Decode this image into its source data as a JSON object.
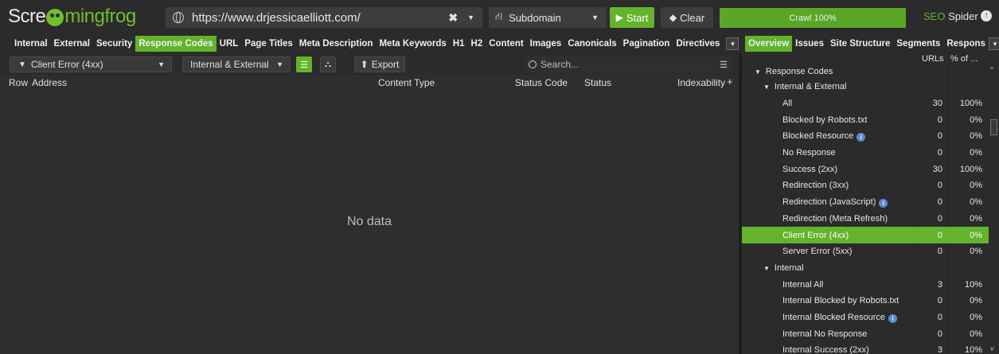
{
  "app": {
    "logo_text_a": "Scre",
    "logo_text_b": "mingfrog",
    "url": "https://www.drjessicaelliott.com/",
    "mode": "Subdomain",
    "start_label": "Start",
    "clear_label": "Clear",
    "crawl_status": "Crawl 100%",
    "product_seo": "SEO",
    "product_spider": "Spider"
  },
  "tabs": [
    "Internal",
    "External",
    "Security",
    "Response Codes",
    "URL",
    "Page Titles",
    "Meta Description",
    "Meta Keywords",
    "H1",
    "H2",
    "Content",
    "Images",
    "Canonicals",
    "Pagination",
    "Directives"
  ],
  "active_tab": "Response Codes",
  "right_tabs": [
    "Overview",
    "Issues",
    "Site Structure",
    "Segments",
    "Respons"
  ],
  "filter": {
    "selected": "Client Error (4xx)",
    "scope": "Internal & External",
    "export_label": "Export",
    "search_placeholder": "Search..."
  },
  "table": {
    "columns": [
      "Row",
      "Address",
      "Content Type",
      "Status Code",
      "Status",
      "Indexability"
    ],
    "empty_text": "No data"
  },
  "overview": {
    "col_urls": "URLs",
    "col_pct": "% of ...",
    "section": "Response Codes",
    "group_internal_external": "Internal & External",
    "group_internal": "Internal",
    "rows_ie": [
      {
        "name": "All",
        "urls": "30",
        "pct": "100%"
      },
      {
        "name": "Blocked by Robots.txt",
        "urls": "0",
        "pct": "0%"
      },
      {
        "name": "Blocked Resource",
        "urls": "0",
        "pct": "0%",
        "info": true
      },
      {
        "name": "No Response",
        "urls": "0",
        "pct": "0%"
      },
      {
        "name": "Success (2xx)",
        "urls": "30",
        "pct": "100%"
      },
      {
        "name": "Redirection (3xx)",
        "urls": "0",
        "pct": "0%"
      },
      {
        "name": "Redirection (JavaScript)",
        "urls": "0",
        "pct": "0%",
        "info": true
      },
      {
        "name": "Redirection (Meta Refresh)",
        "urls": "0",
        "pct": "0%"
      },
      {
        "name": "Client Error (4xx)",
        "urls": "0",
        "pct": "0%",
        "selected": true
      },
      {
        "name": "Server Error (5xx)",
        "urls": "0",
        "pct": "0%"
      }
    ],
    "rows_internal": [
      {
        "name": "Internal All",
        "urls": "3",
        "pct": "10%"
      },
      {
        "name": "Internal Blocked by Robots.txt",
        "urls": "0",
        "pct": "0%"
      },
      {
        "name": "Internal Blocked Resource",
        "urls": "0",
        "pct": "0%",
        "info": true
      },
      {
        "name": "Internal No Response",
        "urls": "0",
        "pct": "0%"
      },
      {
        "name": "Internal Success (2xx)",
        "urls": "3",
        "pct": "10%"
      }
    ]
  },
  "colors": {
    "accent": "#63b32c",
    "info": "#5b8ad6"
  }
}
